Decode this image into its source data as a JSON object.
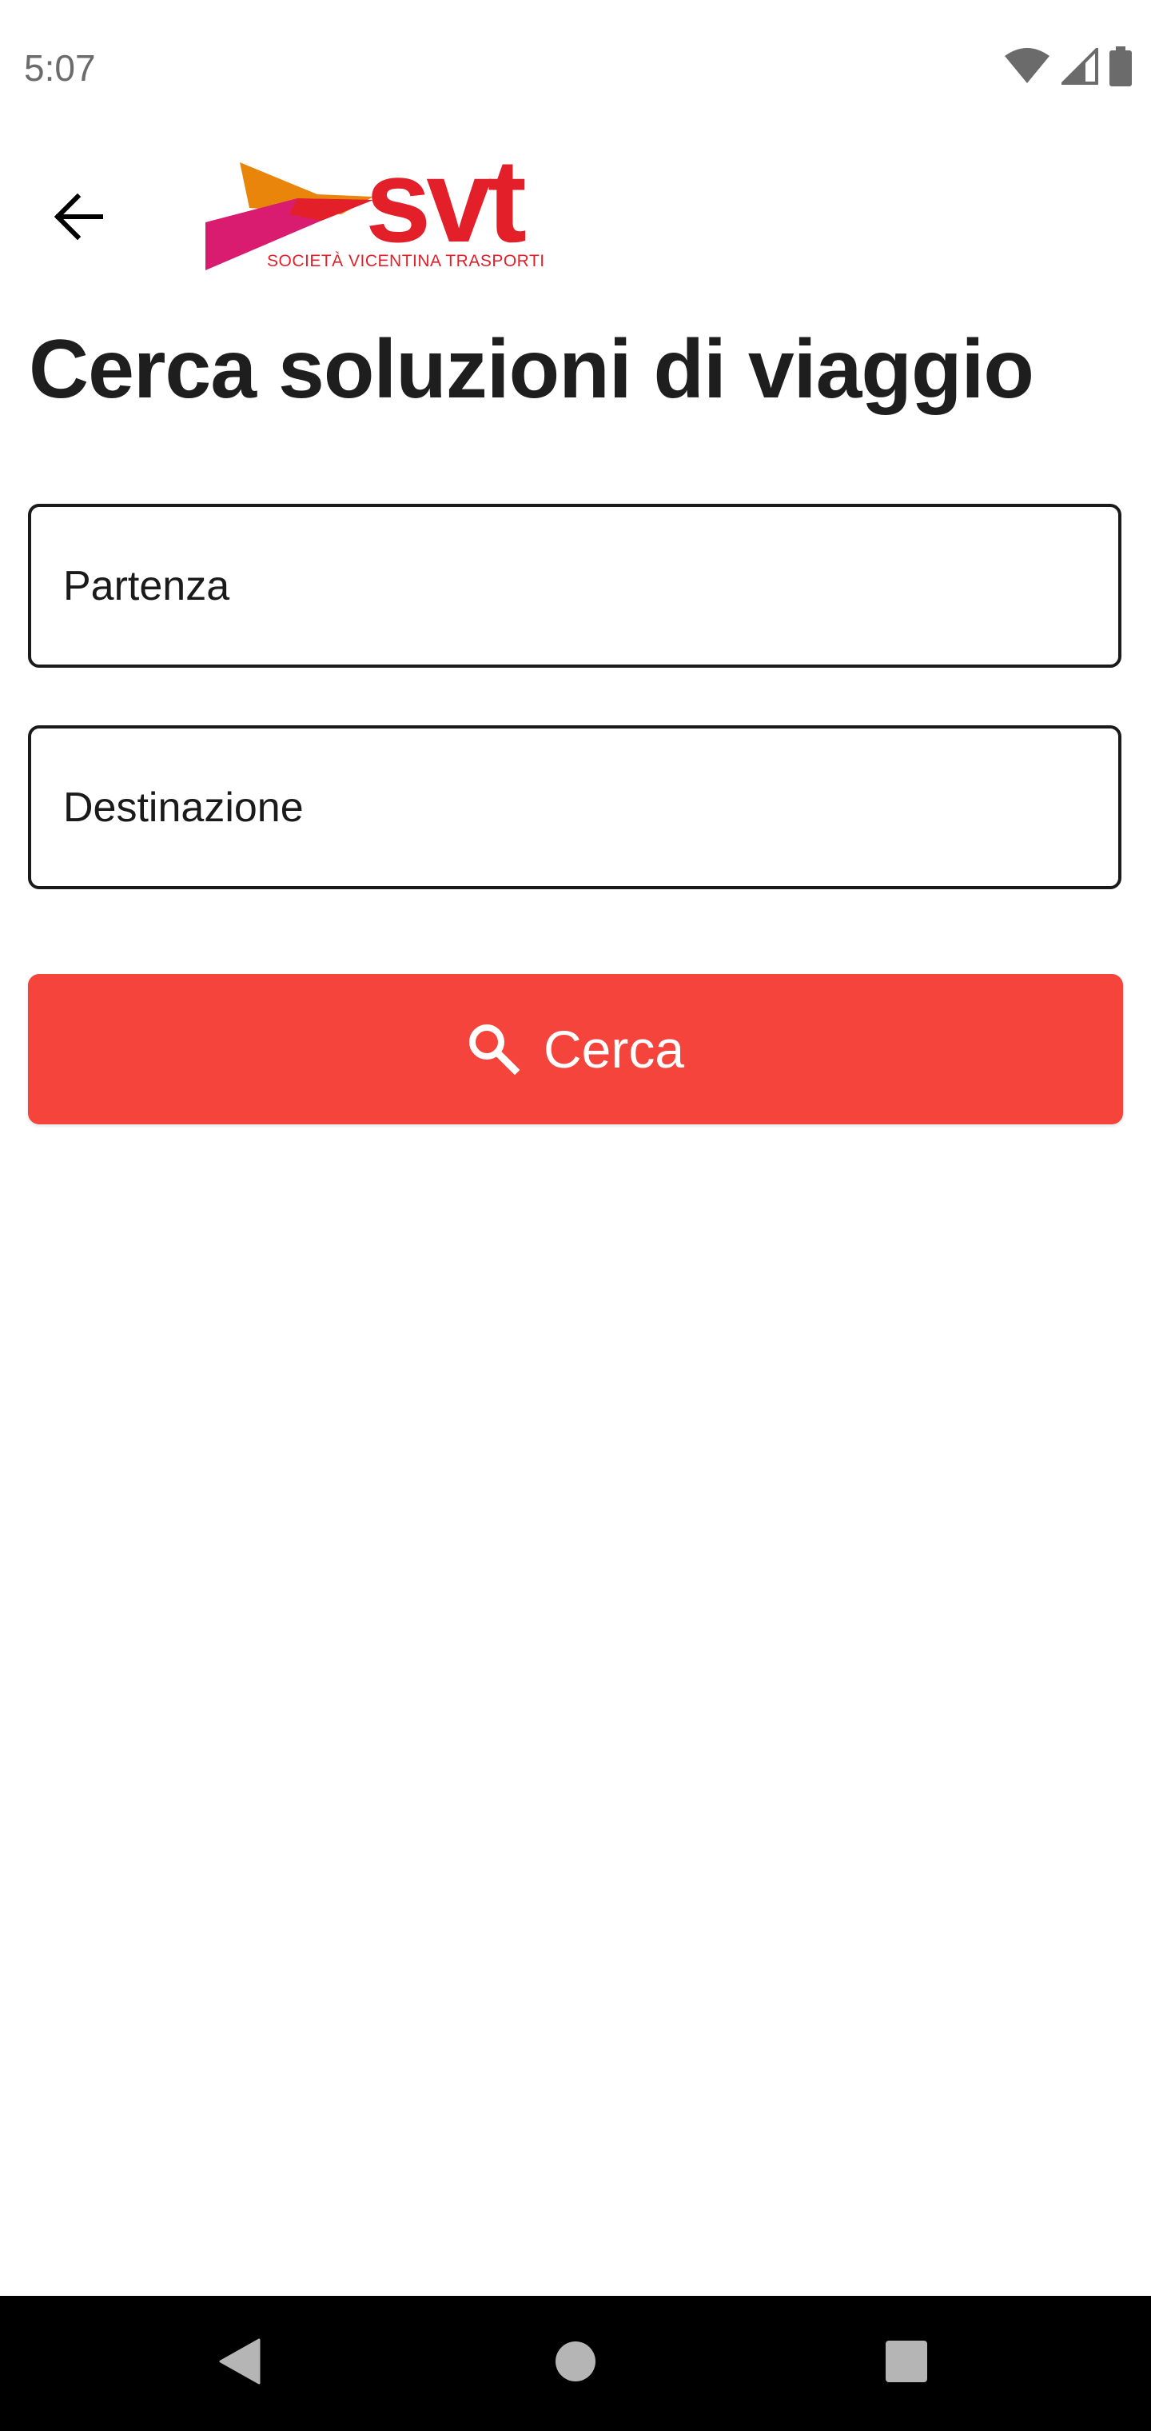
{
  "status_bar": {
    "time": "5:07",
    "icons": [
      "wifi-icon",
      "signal-icon",
      "battery-icon"
    ]
  },
  "app_bar": {
    "back_icon": "arrow-left-icon",
    "logo": {
      "wordmark": "svt",
      "tagline": "SOCIETÀ VICENTINA TRASPORTI"
    }
  },
  "page": {
    "title": "Cerca soluzioni di viaggio"
  },
  "form": {
    "departure": {
      "value": "",
      "placeholder": "Partenza"
    },
    "destination": {
      "value": "",
      "placeholder": "Destinazione"
    },
    "search_button": {
      "icon": "search-icon",
      "label": "Cerca"
    }
  },
  "nav_bar": {
    "buttons": [
      "back-triangle-icon",
      "home-circle-icon",
      "recents-square-icon"
    ]
  },
  "colors": {
    "accent": "#f4443c",
    "brand_red": "#e3202a",
    "brand_orange": "#e8850a",
    "brand_magenta": "#d91c6f",
    "title_text": "#1e1e1e",
    "nav_bar_bg": "#000000"
  }
}
